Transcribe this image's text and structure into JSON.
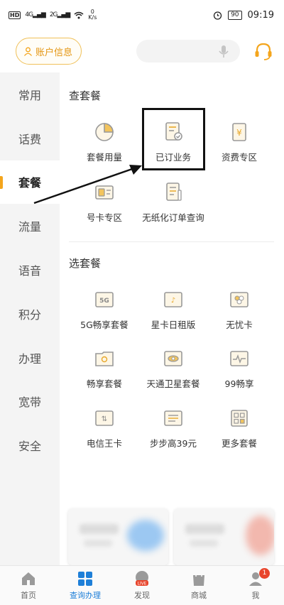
{
  "status_bar": {
    "hd": "HD",
    "net1": "4G",
    "net2": "2G",
    "speed_value": "0",
    "speed_unit": "K/s",
    "battery": "90",
    "time": "09:19"
  },
  "header": {
    "account_label": "账户信息",
    "search_placeholder": ""
  },
  "sidebar": {
    "items": [
      {
        "label": "常用"
      },
      {
        "label": "话费"
      },
      {
        "label": "套餐"
      },
      {
        "label": "流量"
      },
      {
        "label": "语音"
      },
      {
        "label": "积分"
      },
      {
        "label": "办理"
      },
      {
        "label": "宽带"
      },
      {
        "label": "安全"
      }
    ],
    "active_index": 2
  },
  "check_section": {
    "title": "查套餐",
    "items": [
      {
        "label": "套餐用量",
        "icon": "pie-chart-icon"
      },
      {
        "label": "已订业务",
        "icon": "document-check-icon"
      },
      {
        "label": "资费专区",
        "icon": "yuan-receipt-icon"
      },
      {
        "label": "号卡专区",
        "icon": "sim-card-icon"
      },
      {
        "label": "无纸化订单查询",
        "icon": "paperless-order-icon"
      }
    ]
  },
  "choose_section": {
    "title": "选套餐",
    "items": [
      {
        "label": "5G畅享套餐",
        "icon": "5g-card-icon"
      },
      {
        "label": "星卡日租版",
        "icon": "star-card-icon"
      },
      {
        "label": "无忧卡",
        "icon": "worry-free-card-icon"
      },
      {
        "label": "畅享套餐",
        "icon": "folder-card-icon"
      },
      {
        "label": "天通卫星套餐",
        "icon": "satellite-card-icon"
      },
      {
        "label": "99畅享",
        "icon": "pulse-card-icon"
      },
      {
        "label": "电信王卡",
        "icon": "king-card-icon"
      },
      {
        "label": "步步高39元",
        "icon": "stepup-card-icon"
      },
      {
        "label": "更多套餐",
        "icon": "more-grid-icon"
      }
    ]
  },
  "tabbar": {
    "items": [
      {
        "label": "首页",
        "icon": "home-icon"
      },
      {
        "label": "查询办理",
        "icon": "query-grid-icon"
      },
      {
        "label": "发现",
        "icon": "live-icon",
        "live_text": "LIVE"
      },
      {
        "label": "商城",
        "icon": "shopping-bag-icon"
      },
      {
        "label": "我",
        "icon": "profile-icon",
        "badge": "1"
      }
    ],
    "active_index": 1
  },
  "colors": {
    "accent": "#f4a51c",
    "tab_active": "#1e7fd8",
    "sidebar_bg": "#f4f4f4",
    "badge": "#e8452c"
  }
}
